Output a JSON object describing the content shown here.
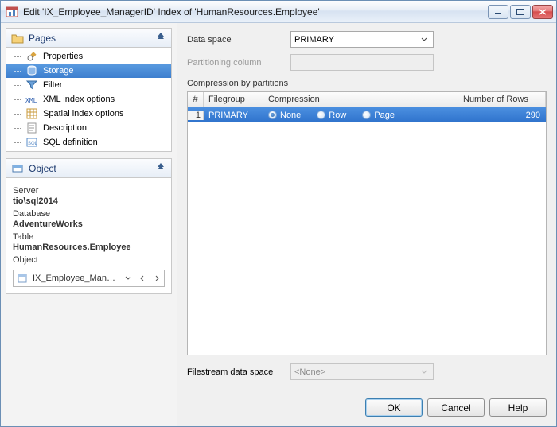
{
  "window": {
    "title": "Edit 'IX_Employee_ManagerID' Index of 'HumanResources.Employee'"
  },
  "pages_panel": {
    "title": "Pages",
    "items": [
      {
        "label": "Properties",
        "selected": false
      },
      {
        "label": "Storage",
        "selected": true
      },
      {
        "label": "Filter",
        "selected": false
      },
      {
        "label": "XML index options",
        "selected": false
      },
      {
        "label": "Spatial index options",
        "selected": false
      },
      {
        "label": "Description",
        "selected": false
      },
      {
        "label": "SQL definition",
        "selected": false
      }
    ]
  },
  "object_panel": {
    "title": "Object",
    "server_label": "Server",
    "server_value": "tio\\sql2014",
    "database_label": "Database",
    "database_value": "AdventureWorks",
    "table_label": "Table",
    "table_value": "HumanResources.Employee",
    "object_label": "Object",
    "object_value": "IX_Employee_ManagerID"
  },
  "form": {
    "data_space_label": "Data space",
    "data_space_value": "PRIMARY",
    "partition_col_label": "Partitioning column",
    "partition_col_value": "",
    "compression_title": "Compression by partitions",
    "columns": {
      "num": "#",
      "filegroup": "Filegroup",
      "compression": "Compression",
      "rows": "Number of Rows"
    },
    "rows": [
      {
        "num": "1",
        "filegroup": "PRIMARY",
        "compression_options": {
          "none": "None",
          "row": "Row",
          "page": "Page"
        },
        "compression_selected": "none",
        "num_rows": "290"
      }
    ],
    "filestream_label": "Filestream data space",
    "filestream_value": "<None>"
  },
  "buttons": {
    "ok": "OK",
    "cancel": "Cancel",
    "help": "Help"
  }
}
